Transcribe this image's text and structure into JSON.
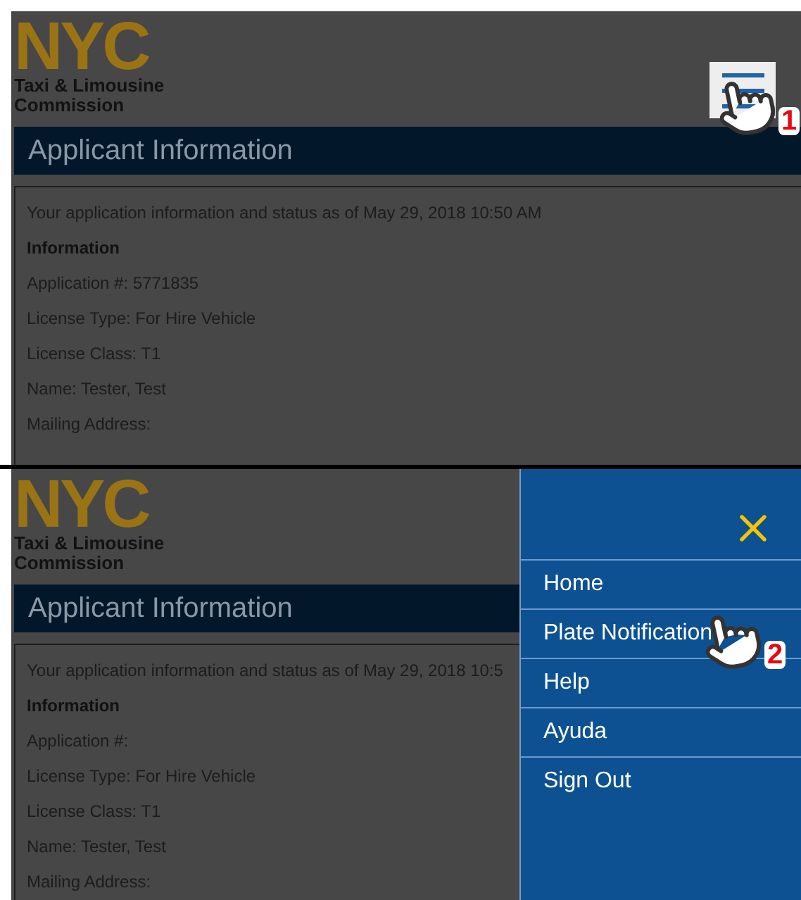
{
  "panels": [
    {
      "logo": {
        "mark": "NYC",
        "lines": [
          "Taxi & Limousine",
          "Commission"
        ]
      },
      "heading": "Applicant Information",
      "status_line": "Your application information and status as of May 29, 2018 10:50 AM",
      "section_title": "Information",
      "fields": [
        "Application #: 5771835",
        "License Type: For Hire Vehicle",
        "License Class: T1",
        "Name: Tester, Test",
        "Mailing Address:"
      ],
      "menu": {
        "open": false
      },
      "step": "1"
    },
    {
      "logo": {
        "mark": "NYC",
        "lines": [
          "Taxi & Limousine",
          "Commission"
        ]
      },
      "heading": "Applicant Information",
      "status_line": "Your application information and status as of May 29, 2018 10:5",
      "section_title": "Information",
      "fields": [
        "Application #:",
        "License Type: For Hire Vehicle",
        "License Class: T1",
        "Name: Tester, Test",
        "Mailing Address:"
      ],
      "menu": {
        "open": true,
        "items": [
          {
            "label": "Home"
          },
          {
            "label": "Plate Notification"
          },
          {
            "label": "Help"
          },
          {
            "label": "Ayuda"
          },
          {
            "label": "Sign Out"
          }
        ]
      },
      "step": "2"
    }
  ]
}
